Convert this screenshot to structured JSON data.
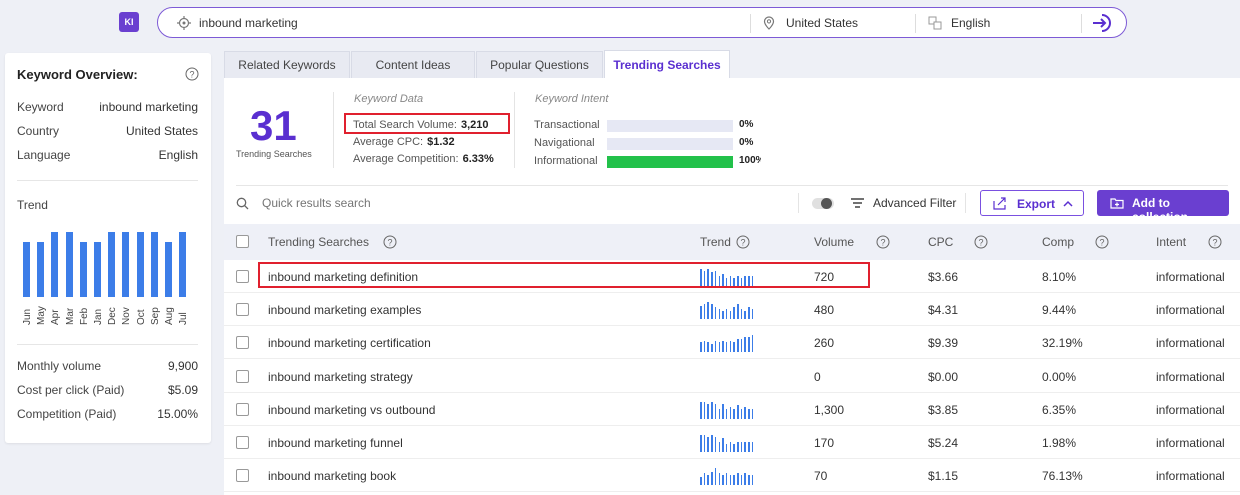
{
  "app": {
    "logo": "KI"
  },
  "search": {
    "query": "inbound marketing",
    "country": "United States",
    "language": "English"
  },
  "overview": {
    "title": "Keyword Overview:",
    "fields": [
      {
        "label": "Keyword",
        "value": "inbound marketing"
      },
      {
        "label": "Country",
        "value": "United States"
      },
      {
        "label": "Language",
        "value": "English"
      }
    ],
    "trend_label": "Trend",
    "trend_months": [
      "Jun",
      "May",
      "Apr",
      "Mar",
      "Feb",
      "Jan",
      "Dec",
      "Nov",
      "Oct",
      "Sep",
      "Aug",
      "Jul"
    ],
    "trend_values": [
      0.73,
      0.73,
      0.85,
      0.85,
      0.73,
      0.73,
      0.85,
      0.85,
      0.85,
      0.85,
      0.73,
      0.85
    ],
    "stats": [
      {
        "label": "Monthly volume",
        "value": "9,900"
      },
      {
        "label": "Cost per click (Paid)",
        "value": "$5.09"
      },
      {
        "label": "Competition (Paid)",
        "value": "15.00%"
      }
    ]
  },
  "tabs": [
    {
      "label": "Related Keywords",
      "active": false
    },
    {
      "label": "Content Ideas",
      "active": false
    },
    {
      "label": "Popular Questions",
      "active": false
    },
    {
      "label": "Trending Searches",
      "active": true
    }
  ],
  "summary": {
    "count": "31",
    "count_label": "Trending Searches",
    "keyword_data_title": "Keyword Data",
    "keyword_data": [
      {
        "label": "Total Search Volume:",
        "value": "3,210"
      },
      {
        "label": "Average CPC:",
        "value": "$1.32"
      },
      {
        "label": "Average Competition:",
        "value": "6.33%"
      }
    ],
    "intent_title": "Keyword Intent",
    "intents": [
      {
        "label": "Transactional",
        "pct": "0%",
        "fraction": 0
      },
      {
        "label": "Navigational",
        "pct": "0%",
        "fraction": 0
      },
      {
        "label": "Informational",
        "pct": "100%",
        "fraction": 1
      }
    ]
  },
  "toolbar": {
    "search_placeholder": "Quick results search",
    "advanced_filter": "Advanced Filter",
    "export": "Export",
    "add_to_collection": "Add to collection"
  },
  "table": {
    "headers": {
      "keyword": "Trending Searches",
      "trend": "Trend",
      "volume": "Volume",
      "cpc": "CPC",
      "comp": "Comp",
      "intent": "Intent"
    },
    "rows": [
      {
        "keyword": "inbound marketing definition",
        "volume": "720",
        "cpc": "$3.66",
        "comp": "8.10%",
        "intent": "informational",
        "trend": [
          1,
          0.9,
          1,
          0.8,
          0.9,
          0.6,
          0.7,
          0.5,
          0.6,
          0.5,
          0.6,
          0.5,
          0.6,
          0.6,
          0.6
        ],
        "highlight": true
      },
      {
        "keyword": "inbound marketing examples",
        "volume": "480",
        "cpc": "$4.31",
        "comp": "9.44%",
        "intent": "informational",
        "trend": [
          0.8,
          0.9,
          1,
          0.9,
          0.7,
          0.6,
          0.5,
          0.6,
          0.5,
          0.7,
          0.9,
          0.6,
          0.5,
          0.7,
          0.6
        ],
        "highlight": false
      },
      {
        "keyword": "inbound marketing certification",
        "volume": "260",
        "cpc": "$9.39",
        "comp": "32.19%",
        "intent": "informational",
        "trend": [
          0.6,
          0.7,
          0.6,
          0.5,
          0.7,
          0.6,
          0.7,
          0.6,
          0.7,
          0.6,
          0.8,
          0.8,
          0.9,
          0.9,
          1
        ],
        "highlight": false
      },
      {
        "keyword": "inbound marketing strategy",
        "volume": "0",
        "cpc": "$0.00",
        "comp": "0.00%",
        "intent": "informational",
        "trend": [],
        "highlight": false
      },
      {
        "keyword": "inbound marketing vs outbound",
        "volume": "1,300",
        "cpc": "$3.85",
        "comp": "6.35%",
        "intent": "informational",
        "trend": [
          1,
          1,
          0.9,
          1,
          0.9,
          0.6,
          0.9,
          0.6,
          0.7,
          0.6,
          0.8,
          0.6,
          0.7,
          0.6,
          0.6
        ],
        "highlight": false
      },
      {
        "keyword": "inbound marketing funnel",
        "volume": "170",
        "cpc": "$5.24",
        "comp": "1.98%",
        "intent": "informational",
        "trend": [
          1,
          1,
          0.9,
          1,
          0.9,
          0.6,
          0.8,
          0.5,
          0.6,
          0.5,
          0.6,
          0.6,
          0.6,
          0.6,
          0.6
        ],
        "highlight": false
      },
      {
        "keyword": "inbound marketing book",
        "volume": "70",
        "cpc": "$1.15",
        "comp": "76.13%",
        "intent": "informational",
        "trend": [
          0.5,
          0.7,
          0.6,
          0.8,
          1,
          0.7,
          0.6,
          0.7,
          0.6,
          0.6,
          0.7,
          0.6,
          0.7,
          0.6,
          0.6
        ],
        "highlight": false
      }
    ]
  },
  "colors": {
    "accent": "#6a3fd0",
    "bar_blue": "#3c7de8",
    "intent_green": "#22c14a",
    "highlight_red": "#e0202e"
  }
}
